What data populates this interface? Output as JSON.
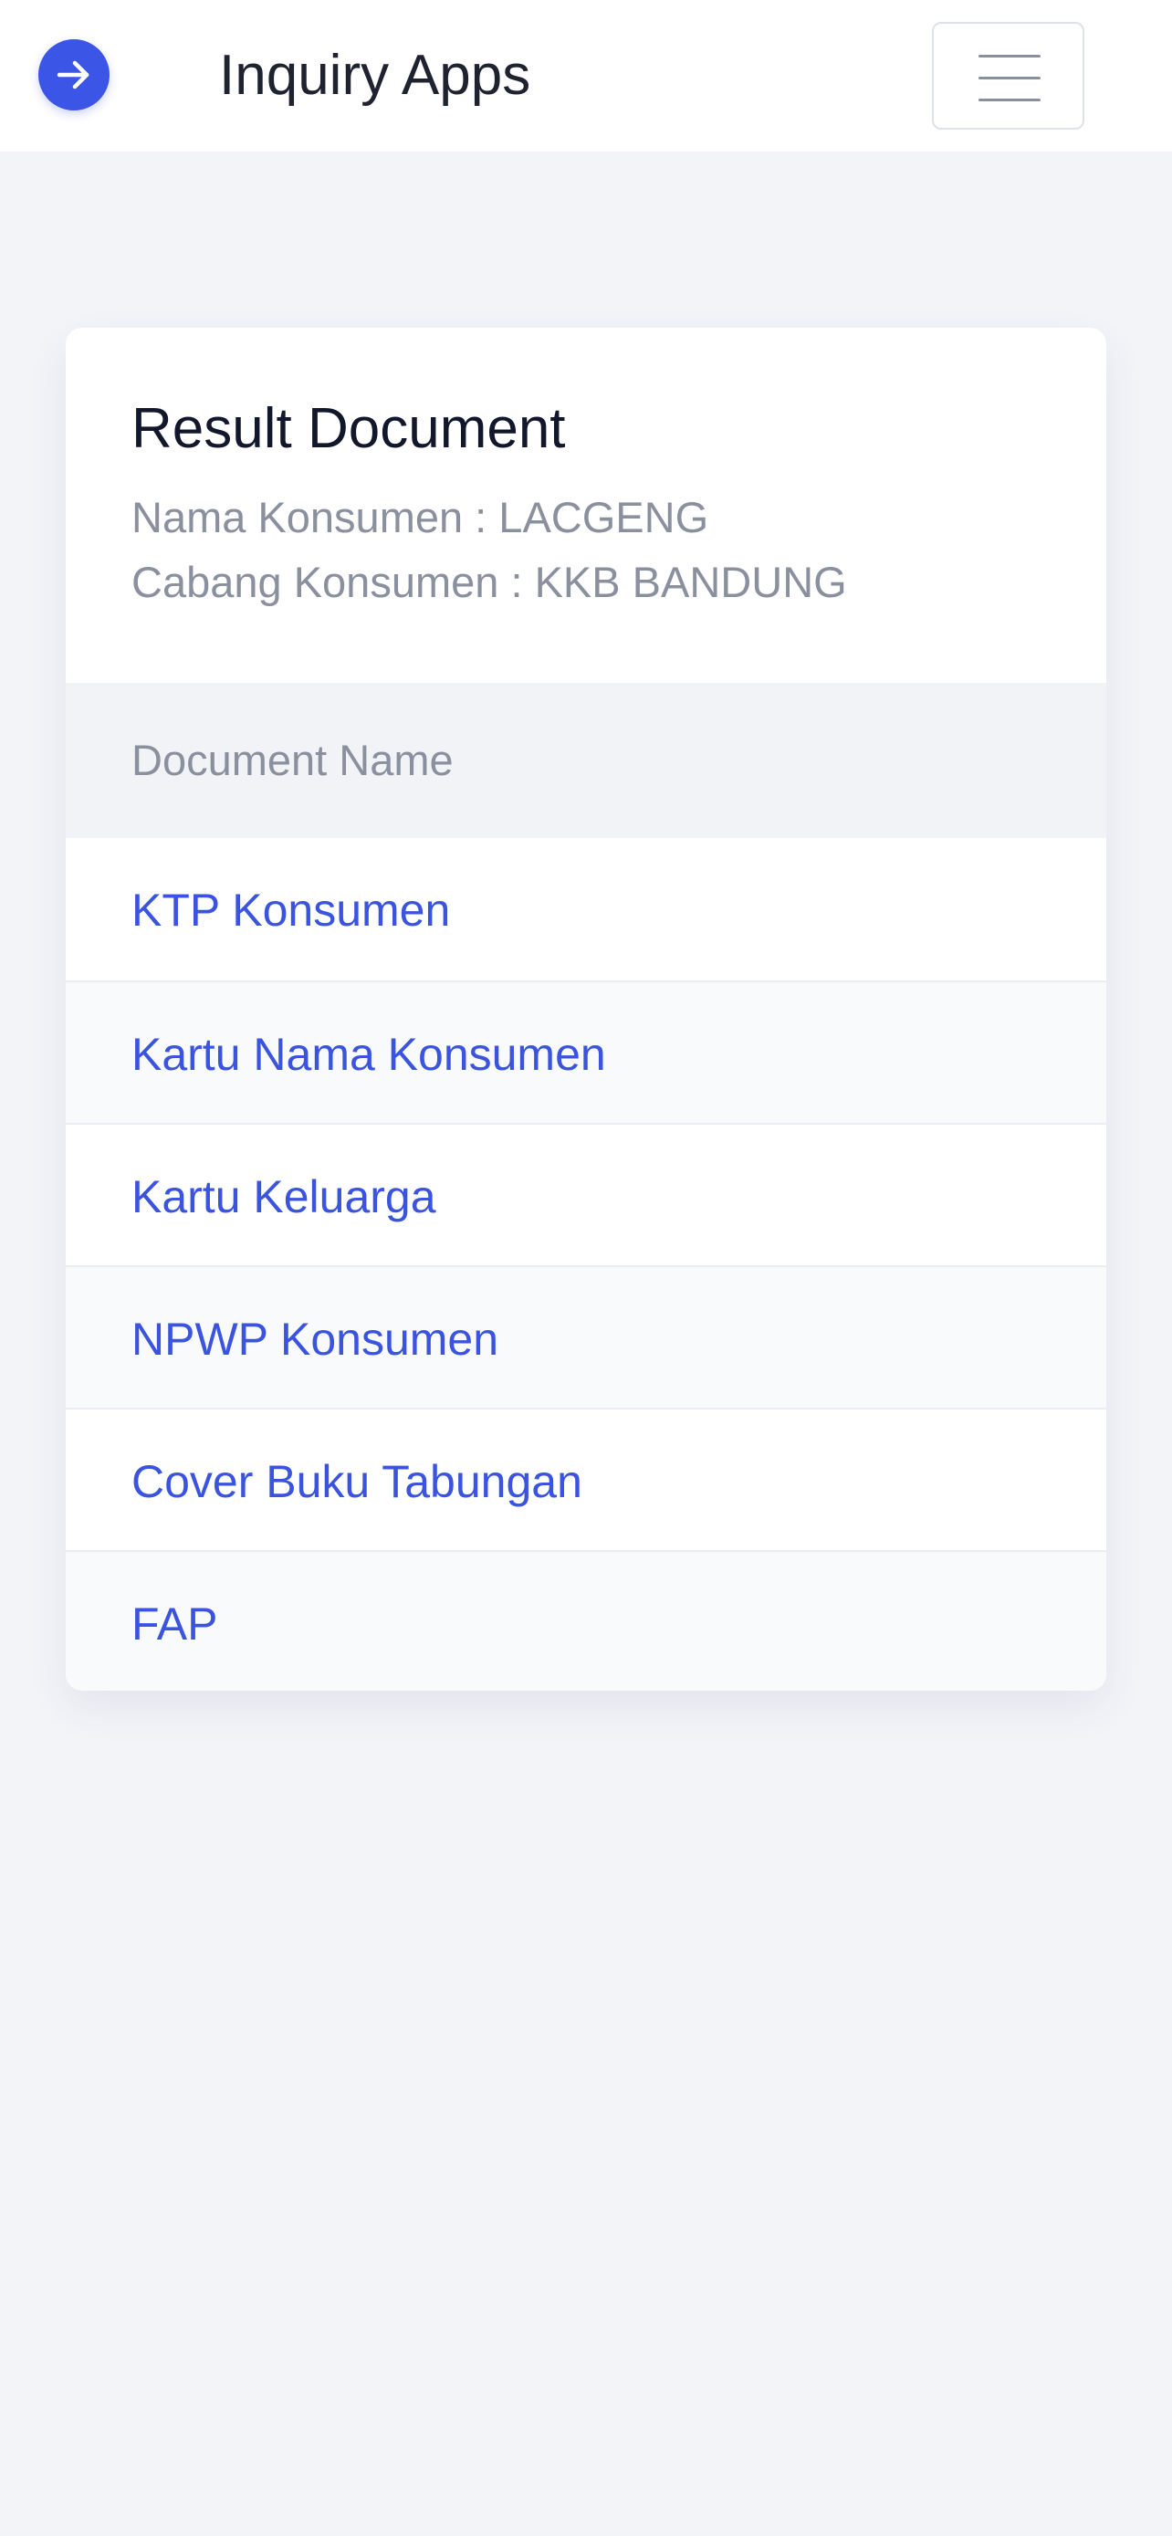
{
  "navbar": {
    "brand_icon": "arrow-right-icon",
    "title": "Inquiry Apps",
    "menu_icon": "hamburger-menu-icon"
  },
  "card": {
    "title": "Result Document",
    "nama_konsumen": "Nama Konsumen : LACGENG",
    "cabang_konsumen": "Cabang Konsumen : KKB BANDUNG"
  },
  "table": {
    "header": "Document Name",
    "rows": [
      "KTP Konsumen",
      "Kartu Nama Konsumen",
      "Kartu Keluarga",
      "NPWP Konsumen",
      "Cover Buku Tabungan",
      "FAP"
    ]
  },
  "colors": {
    "accent": "#3b55e6",
    "link": "#3a54e0",
    "background": "#f3f4f8"
  }
}
